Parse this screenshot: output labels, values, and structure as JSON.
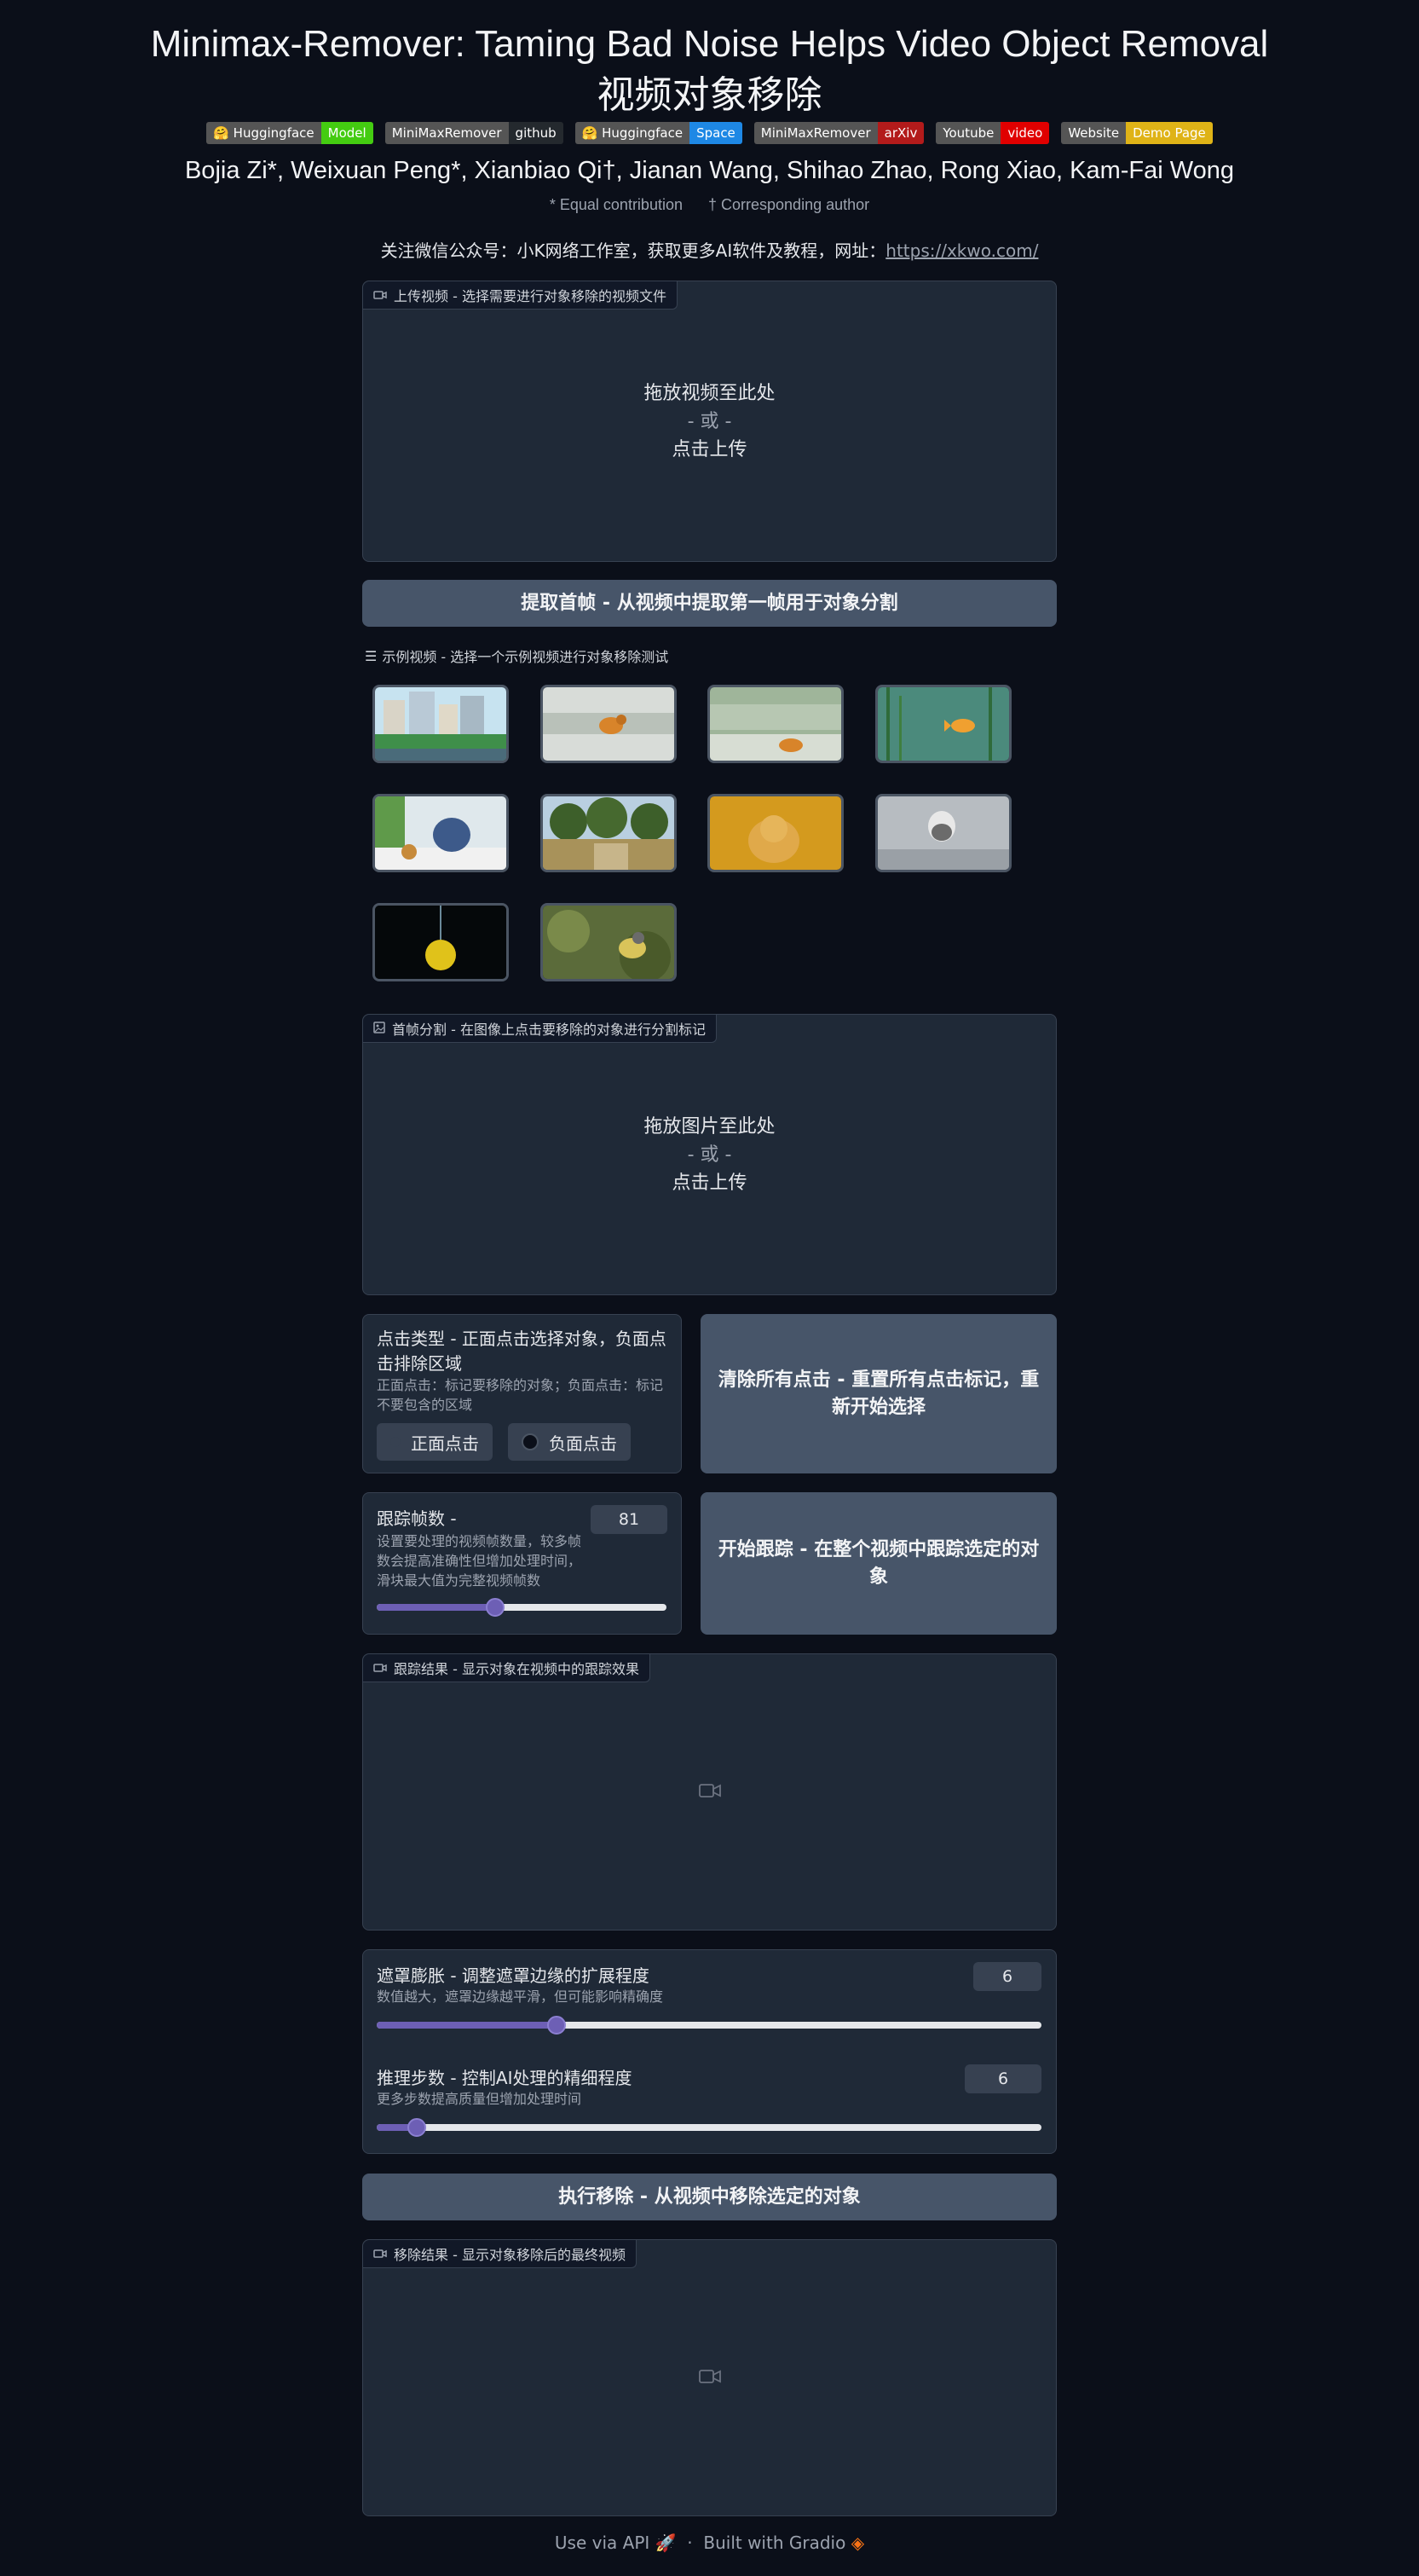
{
  "header": {
    "title_line1": "Minimax-Remover: Taming Bad Noise Helps Video Object Removal",
    "title_line2": "视频对象移除",
    "badges": [
      {
        "left": "🤗 Huggingface",
        "right": "Model",
        "color": "#44cc11"
      },
      {
        "left": "MiniMaxRemover",
        "right": "github",
        "color": "#24292e"
      },
      {
        "left": "🤗 Huggingface",
        "right": "Space",
        "color": "#1e88e5"
      },
      {
        "left": "MiniMaxRemover",
        "right": "arXiv",
        "color": "#b31b1b"
      },
      {
        "left": "Youtube",
        "right": "video",
        "color": "#e00000"
      },
      {
        "left": "Website",
        "right": "Demo Page",
        "color": "#dfb317"
      }
    ],
    "authors": "Bojia Zi*, Weixuan Peng*, Xianbiao Qi†, Jianan Wang, Shihao Zhao, Rong Xiao, Kam-Fai Wong",
    "note_equal": "* Equal contribution",
    "note_corr": "† Corresponding author",
    "wechat_text": "关注微信公众号：小K网络工作室，获取更多AI软件及教程，网址：",
    "wechat_link": "https://xkwo.com/"
  },
  "upload_video": {
    "label": "上传视频 - 选择需要进行对象移除的视频文件",
    "drop": "拖放视频至此处",
    "or": "- 或 -",
    "click": "点击上传"
  },
  "extract_button": "提取首帧 - 从视频中提取第一帧用于对象分割",
  "examples": {
    "label": "示例视频 - 选择一个示例视频进行对象移除测试",
    "items": [
      "city-street",
      "running-dog",
      "running-dog-blur",
      "fish-underwater",
      "cartoon-cat-mouse",
      "farm-field",
      "hamster",
      "bird-water",
      "lemon-splash",
      "bird-branch"
    ]
  },
  "segment": {
    "label": "首帧分割 - 在图像上点击要移除的对象进行分割标记",
    "drop": "拖放图片至此处",
    "or": "- 或 -",
    "click": "点击上传"
  },
  "point_type": {
    "title": "点击类型 - 正面点击选择对象，负面点击排除区域",
    "info": "正面点击：标记要移除的对象；负面点击：标记不要包含的区域",
    "positive": "正面点击",
    "negative": "负面点击",
    "selected": "positive"
  },
  "clear_button": "清除所有点击 - 重置所有点击标记，重新开始选择",
  "track_frames": {
    "title": "跟踪帧数 -",
    "info": "设置要处理的视频帧数量，较多帧数会提高准确性但增加处理时间，滑块最大值为完整视频帧数",
    "value": "81",
    "fraction": 0.41
  },
  "track_button": "开始跟踪 - 在整个视频中跟踪选定的对象",
  "track_result": {
    "label": "跟踪结果 - 显示对象在视频中的跟踪效果"
  },
  "dilation": {
    "title": "遮罩膨胀 - 调整遮罩边缘的扩展程度",
    "info": "数值越大，遮罩边缘越平滑，但可能影响精确度",
    "value": "6",
    "fraction": 0.27
  },
  "steps": {
    "title": "推理步数 - 控制AI处理的精细程度",
    "info": "更多步数提高质量但增加处理时间",
    "value": "6",
    "fraction": 0.06
  },
  "remove_button": "执行移除 - 从视频中移除选定的对象",
  "remove_result": {
    "label": "移除结果 - 显示对象移除后的最终视频"
  },
  "footer": {
    "api": "Use via API",
    "sep": "·",
    "built": "Built with Gradio"
  }
}
